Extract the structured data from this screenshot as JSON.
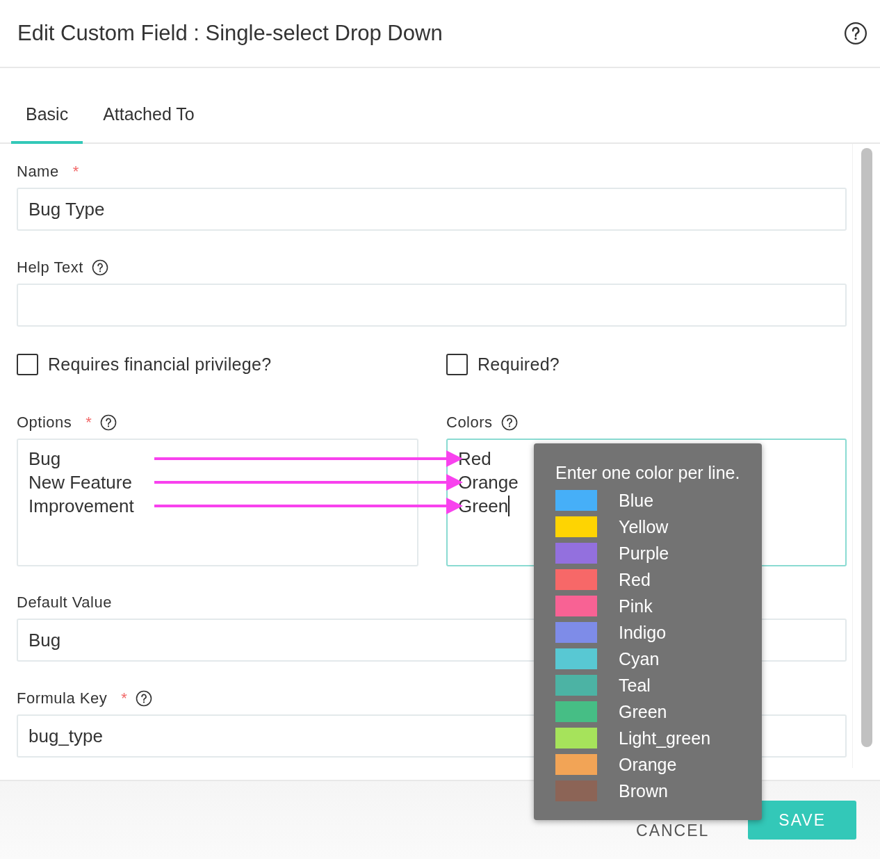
{
  "dialog": {
    "title": "Edit Custom Field : Single-select Drop Down"
  },
  "tabs": [
    {
      "label": "Basic",
      "selected": true
    },
    {
      "label": "Attached To",
      "selected": false
    }
  ],
  "name_field": {
    "label": "Name",
    "required_mark": "*",
    "value": "Bug Type"
  },
  "help_text_field": {
    "label": "Help Text",
    "help_icon": true
  },
  "checkboxes": [
    {
      "label": "Requires financial privilege?",
      "checked": false
    },
    {
      "label": "Required?",
      "checked": false
    }
  ],
  "options_field": {
    "label": "Options",
    "required_mark": "*",
    "help_icon": true,
    "lines": [
      "Bug",
      "New Feature",
      "Improvement"
    ]
  },
  "colors_field": {
    "label": "Colors",
    "help_icon": true,
    "focused": true,
    "lines": [
      "Red",
      "Orange",
      "Green"
    ]
  },
  "default_value_field": {
    "label": "Default Value",
    "value": "Bug"
  },
  "formula_key_field": {
    "label": "Formula Key",
    "required_mark": "*",
    "help_icon": true,
    "value": "bug_type"
  },
  "tooltip": {
    "text": "Enter one color per line.",
    "colors": [
      {
        "name": "Blue",
        "color": "#46aff8"
      },
      {
        "name": "Yellow",
        "color": "#fed402"
      },
      {
        "name": "Purple",
        "color": "#9370de"
      },
      {
        "name": "Red",
        "color": "#f76868"
      },
      {
        "name": "Pink",
        "color": "#f86294"
      },
      {
        "name": "Indigo",
        "color": "#7e8ce8"
      },
      {
        "name": "Cyan",
        "color": "#58c8d3"
      },
      {
        "name": "Teal",
        "color": "#4cb3a4"
      },
      {
        "name": "Green",
        "color": "#46be85"
      },
      {
        "name": "Light_green",
        "color": "#a6e35b"
      },
      {
        "name": "Orange",
        "color": "#f2a456"
      },
      {
        "name": "Brown",
        "color": "#8c6456"
      }
    ]
  },
  "buttons": [
    {
      "label": "CANCEL",
      "kind": "text"
    },
    {
      "label": "SAVE",
      "kind": "primary"
    }
  ]
}
